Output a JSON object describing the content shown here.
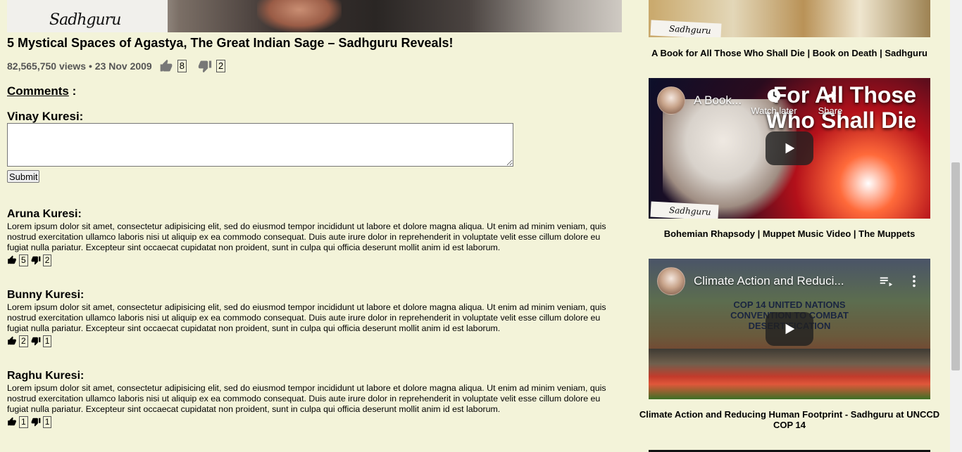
{
  "main": {
    "video_signature": "Sadhguru",
    "title": "5 Mystical Spaces of Agastya, The Great Indian Sage – Sadhguru Reveals!",
    "views_date": "82,565,750 views • 23 Nov 2009",
    "likes": "8",
    "dislikes": "2"
  },
  "comments": {
    "heading": "Comments",
    "heading_suffix": " :",
    "current_user": "Vinay Kuresi:",
    "input_value": "",
    "submit_label": "Submit",
    "items": [
      {
        "author": "Aruna Kuresi:",
        "text": "Lorem ipsum dolor sit amet, consectetur adipisicing elit, sed do eiusmod tempor incididunt ut labore et dolore magna aliqua. Ut enim ad minim veniam, quis nostrud exercitation ullamco laboris nisi ut aliquip ex ea commodo consequat. Duis aute irure dolor in reprehenderit in voluptate velit esse cillum dolore eu fugiat nulla pariatur. Excepteur sint occaecat cupidatat non proident, sunt in culpa qui officia deserunt mollit anim id est laborum.",
        "likes": "5",
        "dislikes": "2"
      },
      {
        "author": "Bunny Kuresi:",
        "text": "Lorem ipsum dolor sit amet, consectetur adipisicing elit, sed do eiusmod tempor incididunt ut labore et dolore magna aliqua. Ut enim ad minim veniam, quis nostrud exercitation ullamco laboris nisi ut aliquip ex ea commodo consequat. Duis aute irure dolor in reprehenderit in voluptate velit esse cillum dolore eu fugiat nulla pariatur. Excepteur sint occaecat cupidatat non proident, sunt in culpa qui officia deserunt mollit anim id est laborum.",
        "likes": "2",
        "dislikes": "1"
      },
      {
        "author": "Raghu Kuresi:",
        "text": "Lorem ipsum dolor sit amet, consectetur adipisicing elit, sed do eiusmod tempor incididunt ut labore et dolore magna aliqua. Ut enim ad minim veniam, quis nostrud exercitation ullamco laboris nisi ut aliquip ex ea commodo consequat. Duis aute irure dolor in reprehenderit in voluptate velit esse cillum dolore eu fugiat nulla pariatur. Excepteur sint occaecat cupidatat non proident, sunt in culpa qui officia deserunt mollit anim id est laborum.",
        "likes": "1",
        "dislikes": "1"
      }
    ]
  },
  "sidebar": {
    "items": [
      {
        "caption": "A Book for All Those Who Shall Die | Book on Death | Sadhguru",
        "signature": "Sadhguru"
      },
      {
        "caption": "Bohemian Rhapsody | Muppet Music Video | The Muppets",
        "player_title": "A Book...",
        "watch_later": "Watch later",
        "share": "Share",
        "overlay_text": "For All Those Who Shall Die",
        "signature": "Sadhguru"
      },
      {
        "caption": "Climate Action and Reducing Human Footprint - Sadhguru at UNCCD COP 14",
        "player_title": "Climate Action and Reduci...",
        "banner_text": "COP 14 UNITED NATIONS CONVENTION TO COMBAT DESERTIFICATION"
      }
    ]
  },
  "colors": {
    "background": "#f3f3d9",
    "meta_text": "#555555",
    "player_button": "#212121"
  },
  "icons": [
    "thumbs-up-icon",
    "thumbs-down-icon",
    "clock-icon",
    "share-icon",
    "play-icon",
    "playlist-icon",
    "more-vert-icon"
  ]
}
